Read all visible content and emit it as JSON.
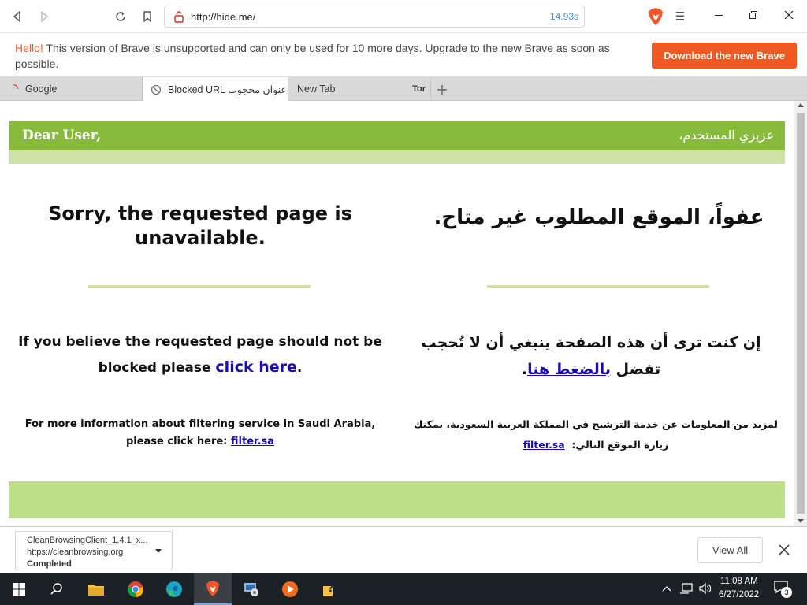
{
  "toolbar": {
    "url": "http://hide.me/",
    "load_time": "14.93s",
    "icons": [
      "back-icon",
      "forward-icon",
      "reload-icon",
      "bookmark-icon",
      "brave-lion-icon",
      "menu-icon",
      "minimize-icon",
      "restore-icon",
      "close-icon"
    ]
  },
  "banner": {
    "hello": "Hello!",
    "message": " This version of Brave is unsupported and can only be used for 10 more days. Upgrade to the new Brave as soon as possible.",
    "button": "Download the new Brave"
  },
  "tabs": [
    {
      "label": "Google"
    },
    {
      "label": "Blocked URL عنوان محجوب"
    },
    {
      "label": "New Tab",
      "badge": "Tor"
    }
  ],
  "page": {
    "greeting_en": "Dear User,",
    "greeting_ar": "عزيزي المستخدم،",
    "sorry_en": "Sorry, the requested page is unavailable.",
    "sorry_ar": "عفواً، الموقع المطلوب غير متاح.",
    "believe_en_pre": "If you believe the requested page should not be blocked please ",
    "believe_en_link": "click here",
    "believe_en_post": ".",
    "believe_ar_pre": "إن كنت ترى أن هذه الصفحة ينبغي أن لا تُحجب تفضل ",
    "believe_ar_link": "بالضغط هنا",
    "believe_ar_post": ".",
    "more_en_pre": "For more information about filtering service in Saudi Arabia, please click here: ",
    "more_en_link": "filter.sa",
    "more_ar_pre": "لمزيد من المعلومات عن خدمة الترشيح في المملكة العربية السعودية، يمكنك زيارة الموقع التالي: ",
    "more_ar_link": "filter.sa"
  },
  "downloads": {
    "file_name": "CleanBrowsingClient_1.4.1_x...",
    "source": "https://cleanbrowsing.org",
    "status": "Completed",
    "view_all": "View All"
  },
  "taskbar": {
    "time": "11:08 AM",
    "date": "6/27/2022",
    "notifications": "3"
  },
  "colors": {
    "brand_orange": "#f05a22",
    "header_green": "#88bb3c",
    "light_green": "#cfe3a6",
    "footer_green": "#bcdf88",
    "link_blue": "#1a0dab"
  }
}
